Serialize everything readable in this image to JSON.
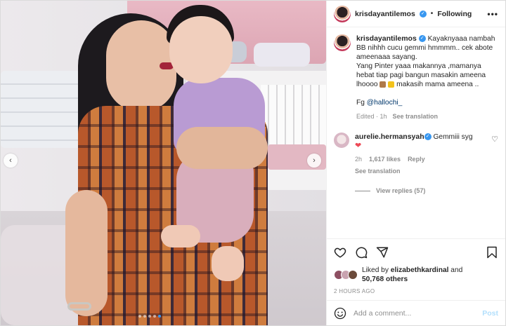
{
  "post": {
    "author": "krisdayantilemos",
    "separator": "•",
    "follow_label": "Following",
    "more_label": "•••",
    "carousel": {
      "active_index": 4,
      "count": 5
    }
  },
  "caption": {
    "username": "krisdayantilemos",
    "line1": "Kayaknyaaa nambah BB nihhh cucu gemmi hmmmm.. cek abote ameenaaa sayang.",
    "line2": "Yang Pinter yaaa makannya ,mamanya hebat tiap pagi bangun masakin ameena lhoooo",
    "line2_tail": "makasih mama ameena ..",
    "fg_prefix": "Fg ",
    "fg_mention": "@hallochi_",
    "edited": "Edited · 1h",
    "see_translation": "See translation"
  },
  "comment": {
    "username": "aurelie.hermansyah",
    "text": "Gemmiii syg",
    "heart": "❤",
    "time": "2h",
    "likes": "1,617 likes",
    "reply": "Reply",
    "see_translation": "See translation",
    "view_replies": "View replies (57)"
  },
  "likes": {
    "prefix": "Liked by ",
    "user": "elizabethkardinal",
    "and": " and",
    "others": "50,768 others"
  },
  "timestamp": "2 HOURS AGO",
  "composer": {
    "placeholder": "Add a comment...",
    "post_label": "Post"
  },
  "colors": {
    "verified": "#3897f0",
    "post_button": "#b2dffc",
    "heart": "#ed4956"
  },
  "icons": [
    "chevron-left-icon",
    "chevron-right-icon",
    "heart-icon",
    "comment-icon",
    "share-icon",
    "bookmark-icon",
    "smiley-icon",
    "verified-icon"
  ]
}
